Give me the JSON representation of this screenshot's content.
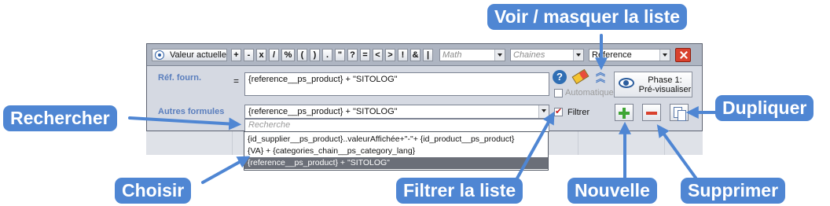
{
  "toolbar": {
    "valeur_actuelle": "Valeur actuelle",
    "operators": [
      "+",
      "-",
      "x",
      "/",
      "%",
      "(",
      ")",
      ".",
      "\"",
      "?",
      "=",
      "<",
      ">",
      "!",
      "&",
      "|"
    ],
    "math_placeholder": "Math",
    "chaines_placeholder": "Chaines",
    "reference_value": "Reference",
    "close_icon": "close-icon"
  },
  "form": {
    "ref_label": "Réf. fourn.",
    "equals": "=",
    "ref_value": "{reference__ps_product} + \"SITOLOG\"",
    "autres_label": "Autres formules",
    "autres_value": "{reference__ps_product} + \"SITOLOG\"",
    "search_placeholder": "Recherche",
    "filtrer_label": "Filtrer",
    "filtrer_checked": true,
    "automatique_label": "Automatique",
    "phase_label": "Phase 1:",
    "phase_sub": "Pré-visualiser",
    "help_glyph": "?"
  },
  "dropdown_items": [
    "{id_supplier__ps_product}..valeurAffichée+\"-\"+ {id_product__ps_product}",
    "{VA} + {categories_chain__ps_category_lang}",
    "{reference__ps_product} + \"SITOLOG\""
  ],
  "dropdown_selected_index": 2,
  "callouts": {
    "voir": "Voir / masquer la liste",
    "rechercher": "Rechercher",
    "dupliquer": "Dupliquer",
    "choisir": "Choisir",
    "filtrer": "Filtrer la liste",
    "nouvelle": "Nouvelle",
    "supprimer": "Supprimer"
  },
  "colors": {
    "callout": "#4f86d3",
    "label": "#5a7ebd",
    "plus": "#3fa535",
    "minus": "#d9412e"
  }
}
